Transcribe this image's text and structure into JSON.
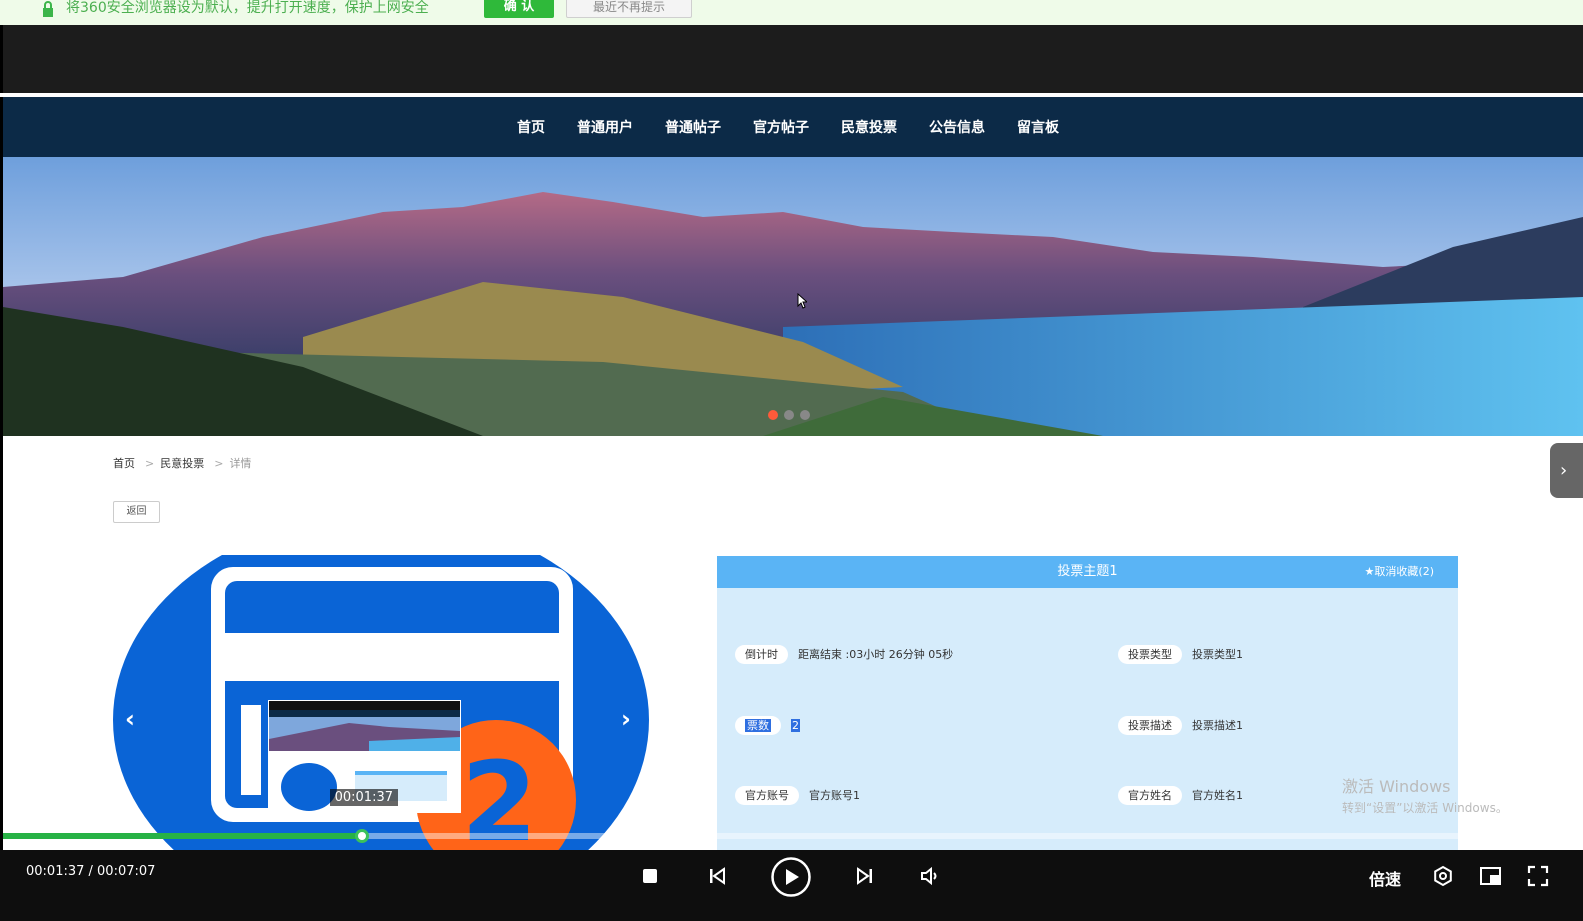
{
  "notification": {
    "message": "将360安全浏览器设为默认，提升打开速度，保护上网安全",
    "confirm_label": "确 认",
    "dismiss_label": "最近不再提示"
  },
  "nav": {
    "items": [
      "首页",
      "普通用户",
      "普通帖子",
      "官方帖子",
      "民意投票",
      "公告信息",
      "留言板"
    ]
  },
  "banner": {
    "slide_count": 3,
    "active_slide": 1
  },
  "breadcrumb": {
    "home": "首页",
    "section": "民意投票",
    "current": "详情",
    "separator": ">"
  },
  "back_label": "返回",
  "detail": {
    "title": "投票主题1",
    "favorite_label": "★取消收藏(2)",
    "countdown_label": "倒计时",
    "countdown_value": "距离结束 :03小时 26分钟 05秒",
    "type_label": "投票类型",
    "type_value": "投票类型1",
    "votes_label": "票数",
    "votes_value": "2",
    "desc_label": "投票描述",
    "desc_value": "投票描述1",
    "account_label": "官方账号",
    "account_value": "官方账号1",
    "name_label": "官方姓名",
    "name_value": "官方姓名1"
  },
  "watermark": {
    "line1": "激活 Windows",
    "line2": "转到“设置”以激活 Windows。"
  },
  "player": {
    "time_display": "00:01:37 / 00:07:07",
    "preview_time": "00:01:37",
    "progress_fraction": 0.227,
    "speed_label": "倍速",
    "accent_color": "#27b245"
  },
  "icons": [
    "lock-icon",
    "chevron-left-icon",
    "chevron-right-icon",
    "stop-icon",
    "previous-icon",
    "play-icon",
    "next-icon",
    "volume-icon",
    "settings-icon",
    "pip-icon",
    "fullscreen-icon"
  ]
}
